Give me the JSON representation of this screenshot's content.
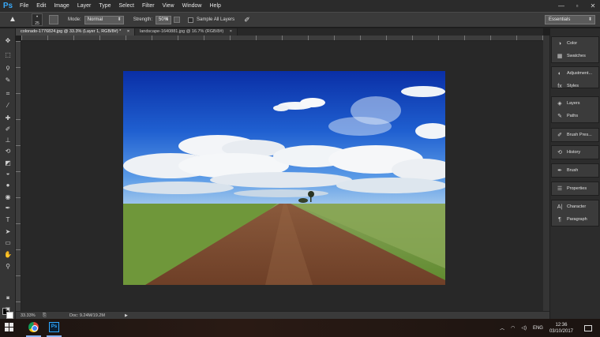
{
  "app": {
    "logo": "Ps"
  },
  "menu": [
    "File",
    "Edit",
    "Image",
    "Layer",
    "Type",
    "Select",
    "Filter",
    "View",
    "Window",
    "Help"
  ],
  "window_controls": {
    "minimize": "—",
    "maximize": "▫",
    "close": "✕"
  },
  "options": {
    "brush_size": "25",
    "mode_label": "Mode:",
    "mode_value": "Normal",
    "strength_label": "Strength:",
    "strength_value": "50%",
    "sample_all_layers": "Sample All Layers",
    "workspace": "Essentials"
  },
  "tabs": [
    {
      "label": "colorado-1776824.jpg @ 33.3% (Layer 1, RGB/8#) *",
      "close": "×",
      "active": true
    },
    {
      "label": "landscape-1640881.jpg @ 16.7% (RGB/8#)",
      "close": "×",
      "active": false
    }
  ],
  "status": {
    "zoom": "33.33%",
    "doc": "Doc: 9.24M/19.2M",
    "arrow": "▶"
  },
  "panels": [
    {
      "items": [
        {
          "icon": "color-icon",
          "glyph": "◑",
          "label": "Color"
        },
        {
          "icon": "swatches-icon",
          "glyph": "▦",
          "label": "Swatches"
        }
      ]
    },
    {
      "items": [
        {
          "icon": "adjustments-icon",
          "glyph": "◐",
          "label": "Adjustment..."
        },
        {
          "icon": "styles-icon",
          "glyph": "fx",
          "label": "Styles"
        }
      ]
    },
    {
      "items": [
        {
          "icon": "layers-icon",
          "glyph": "◈",
          "label": "Layers"
        },
        {
          "icon": "paths-icon",
          "glyph": "✎",
          "label": "Paths"
        }
      ]
    },
    {
      "items": [
        {
          "icon": "brush-presets-icon",
          "glyph": "✐",
          "label": "Brush Pres..."
        }
      ]
    },
    {
      "items": [
        {
          "icon": "history-icon",
          "glyph": "⟲",
          "label": "History"
        }
      ]
    },
    {
      "items": [
        {
          "icon": "brush-icon",
          "glyph": "✒",
          "label": "Brush"
        }
      ]
    },
    {
      "items": [
        {
          "icon": "properties-icon",
          "glyph": "☰",
          "label": "Properties"
        }
      ]
    },
    {
      "items": [
        {
          "icon": "character-icon",
          "glyph": "A|",
          "label": "Character"
        },
        {
          "icon": "paragraph-icon",
          "glyph": "¶",
          "label": "Paragraph"
        }
      ]
    }
  ],
  "taskbar": {
    "ps_label": "Ps",
    "language": "ENG",
    "time": "12:36",
    "date": "03/10/2017"
  },
  "colors": {
    "foreground": "#000000",
    "background": "#ffffff",
    "accent": "#31a8ff"
  }
}
